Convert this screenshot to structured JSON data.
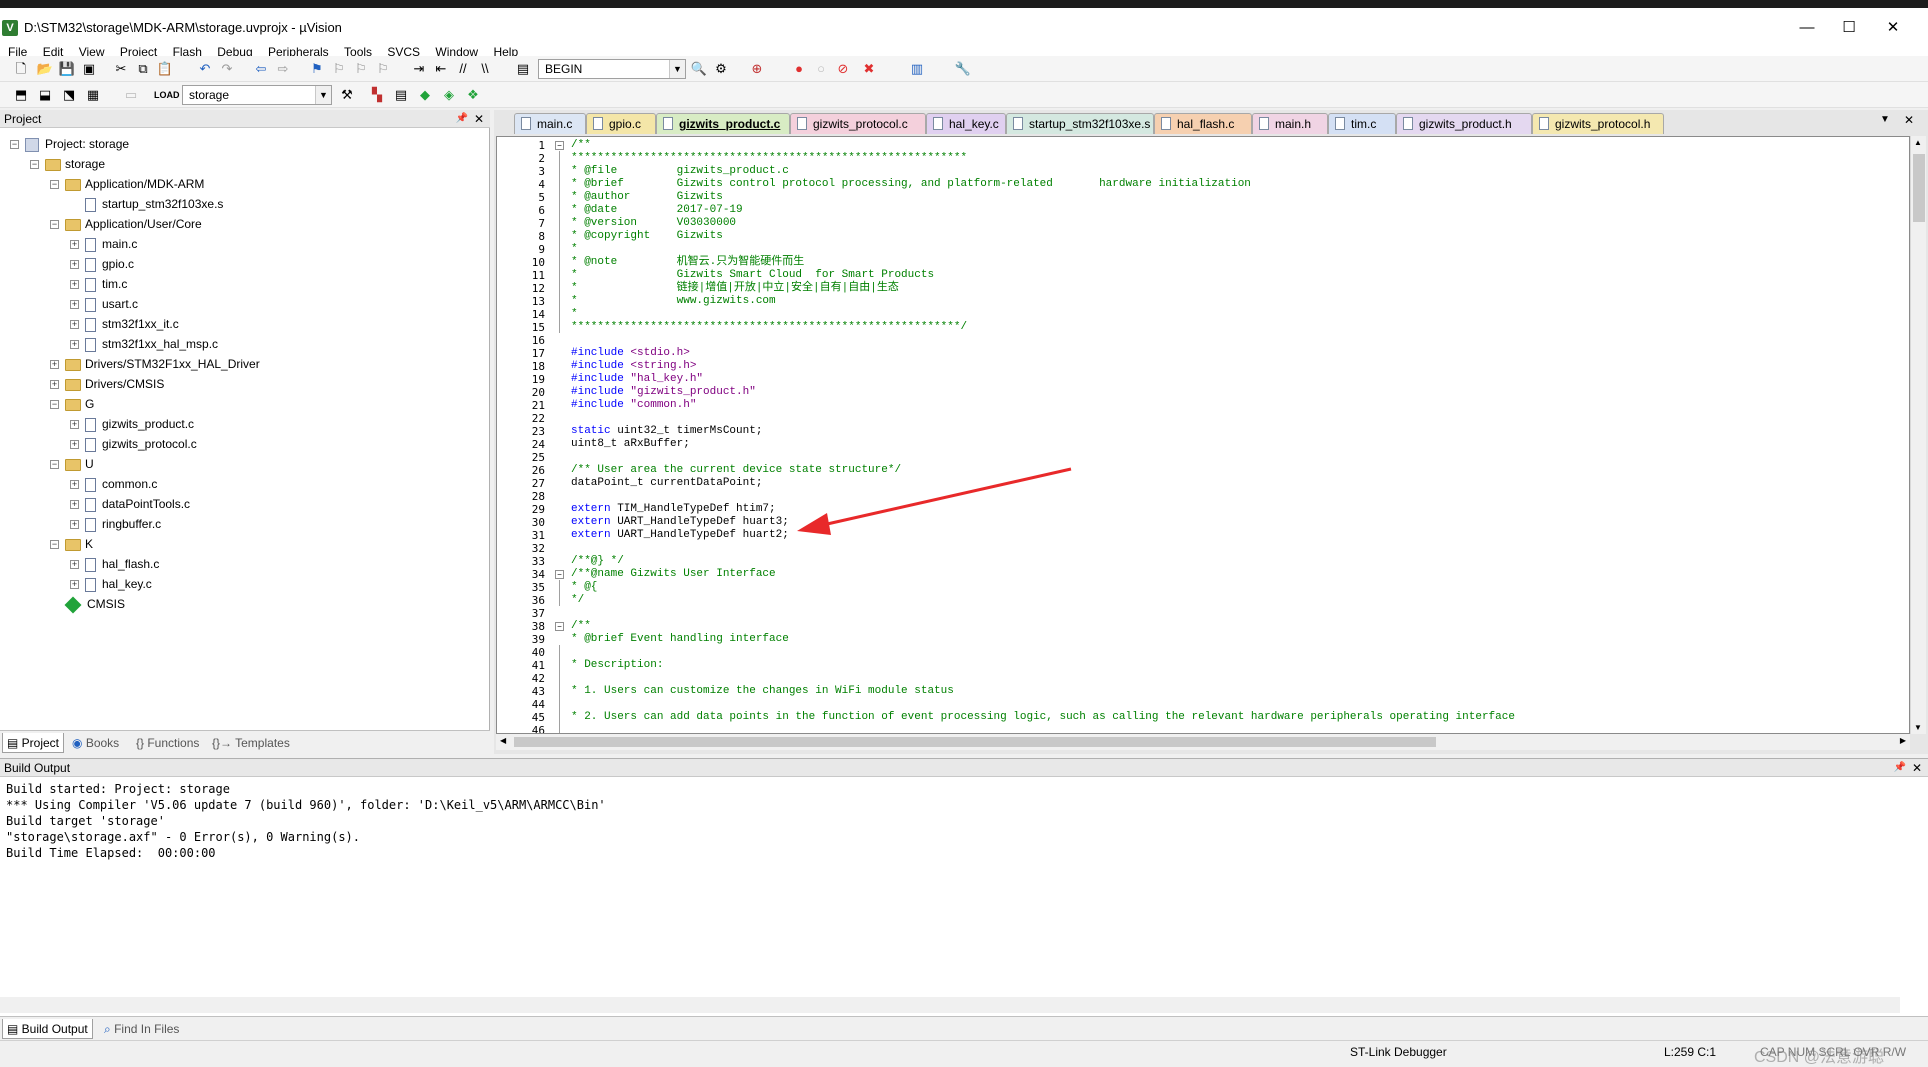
{
  "window": {
    "title": "D:\\STM32\\storage\\MDK-ARM\\storage.uvprojx - µVision",
    "app_icon_label": "V",
    "controls": {
      "minimize": "—",
      "maximize": "☐",
      "close": "✕"
    }
  },
  "menu": [
    "File",
    "Edit",
    "View",
    "Project",
    "Flash",
    "Debug",
    "Peripherals",
    "Tools",
    "SVCS",
    "Window",
    "Help"
  ],
  "toolbar1": {
    "find_combo": "BEGIN"
  },
  "toolbar2": {
    "target_combo": "storage"
  },
  "project_panel": {
    "title": "Project",
    "pin": "📌",
    "close": "✕",
    "tree": [
      {
        "label": "Project: storage",
        "level": 0,
        "kind": "project",
        "exp": "−"
      },
      {
        "label": "storage",
        "level": 1,
        "kind": "folder",
        "exp": "−"
      },
      {
        "label": "Application/MDK-ARM",
        "level": 2,
        "kind": "folder",
        "exp": "−"
      },
      {
        "label": "startup_stm32f103xe.s",
        "level": 3,
        "kind": "file",
        "exp": ""
      },
      {
        "label": "Application/User/Core",
        "level": 2,
        "kind": "folder",
        "exp": "−"
      },
      {
        "label": "main.c",
        "level": 3,
        "kind": "file",
        "exp": "+"
      },
      {
        "label": "gpio.c",
        "level": 3,
        "kind": "file",
        "exp": "+"
      },
      {
        "label": "tim.c",
        "level": 3,
        "kind": "file",
        "exp": "+"
      },
      {
        "label": "usart.c",
        "level": 3,
        "kind": "file",
        "exp": "+"
      },
      {
        "label": "stm32f1xx_it.c",
        "level": 3,
        "kind": "file",
        "exp": "+"
      },
      {
        "label": "stm32f1xx_hal_msp.c",
        "level": 3,
        "kind": "file",
        "exp": "+"
      },
      {
        "label": "Drivers/STM32F1xx_HAL_Driver",
        "level": 2,
        "kind": "folder",
        "exp": "+"
      },
      {
        "label": "Drivers/CMSIS",
        "level": 2,
        "kind": "folder",
        "exp": "+"
      },
      {
        "label": "G",
        "level": 2,
        "kind": "folder",
        "exp": "−"
      },
      {
        "label": "gizwits_product.c",
        "level": 3,
        "kind": "file",
        "exp": "+"
      },
      {
        "label": "gizwits_protocol.c",
        "level": 3,
        "kind": "file",
        "exp": "+"
      },
      {
        "label": "U",
        "level": 2,
        "kind": "folder",
        "exp": "−"
      },
      {
        "label": "common.c",
        "level": 3,
        "kind": "file",
        "exp": "+"
      },
      {
        "label": "dataPointTools.c",
        "level": 3,
        "kind": "file",
        "exp": "+"
      },
      {
        "label": "ringbuffer.c",
        "level": 3,
        "kind": "file",
        "exp": "+"
      },
      {
        "label": "K",
        "level": 2,
        "kind": "folder",
        "exp": "−"
      },
      {
        "label": "hal_flash.c",
        "level": 3,
        "kind": "file",
        "exp": "+"
      },
      {
        "label": "hal_key.c",
        "level": 3,
        "kind": "file",
        "exp": "+"
      },
      {
        "label": "CMSIS",
        "level": 2,
        "kind": "cmsis",
        "exp": ""
      }
    ],
    "tabs": [
      "Project",
      "Books",
      "{} Functions",
      "{}→ Templates"
    ]
  },
  "editor": {
    "tabs": [
      {
        "label": "main.c",
        "color": "#dce6f4"
      },
      {
        "label": "gpio.c",
        "color": "#f4e6a8"
      },
      {
        "label": "gizwits_product.c",
        "color": "#d8ecc4",
        "active": true
      },
      {
        "label": "gizwits_protocol.c",
        "color": "#f4d0dc"
      },
      {
        "label": "hal_key.c",
        "color": "#e0d0f0"
      },
      {
        "label": "startup_stm32f103xe.s",
        "color": "#d4e8e0"
      },
      {
        "label": "hal_flash.c",
        "color": "#f6d0b0"
      },
      {
        "label": "main.h",
        "color": "#f0d4e4"
      },
      {
        "label": "tim.c",
        "color": "#d4e0f4"
      },
      {
        "label": "gizwits_product.h",
        "color": "#e4d8f0"
      },
      {
        "label": "gizwits_protocol.h",
        "color": "#f4e8b0"
      }
    ],
    "tab_menu_icon": "▼",
    "tab_close_icon": "✕",
    "lines": [
      {
        "n": "1",
        "t": "/**",
        "c": "cm",
        "fold": "−"
      },
      {
        "n": "2",
        "t": "************************************************************",
        "c": "cm"
      },
      {
        "n": "3",
        "t": "* @file         gizwits_product.c",
        "c": "cm"
      },
      {
        "n": "4",
        "t": "* @brief        Gizwits control protocol processing, and platform-related       hardware initialization",
        "c": "cm"
      },
      {
        "n": "5",
        "t": "* @author       Gizwits",
        "c": "cm"
      },
      {
        "n": "6",
        "t": "* @date         2017-07-19",
        "c": "cm"
      },
      {
        "n": "7",
        "t": "* @version      V03030000",
        "c": "cm"
      },
      {
        "n": "8",
        "t": "* @copyright    Gizwits",
        "c": "cm"
      },
      {
        "n": "9",
        "t": "*",
        "c": "cm"
      },
      {
        "n": "10",
        "t": "* @note         机智云.只为智能硬件而生",
        "c": "cm"
      },
      {
        "n": "11",
        "t": "*               Gizwits Smart Cloud  for Smart Products",
        "c": "cm"
      },
      {
        "n": "12",
        "t": "*               链接|增值|开放|中立|安全|自有|自由|生态",
        "c": "cm"
      },
      {
        "n": "13",
        "t": "*               www.gizwits.com",
        "c": "cm"
      },
      {
        "n": "14",
        "t": "*",
        "c": "cm"
      },
      {
        "n": "15",
        "t": "***********************************************************/",
        "c": "cm"
      },
      {
        "n": "16",
        "t": "",
        "c": "tx"
      },
      {
        "n": "17",
        "t": "#include <stdio.h>",
        "c": "pp"
      },
      {
        "n": "18",
        "t": "#include <string.h>",
        "c": "pp"
      },
      {
        "n": "19",
        "t": "#include \"hal_key.h\"",
        "c": "pp"
      },
      {
        "n": "20",
        "t": "#include \"gizwits_product.h\"",
        "c": "pp"
      },
      {
        "n": "21",
        "t": "#include \"common.h\"",
        "c": "pp"
      },
      {
        "n": "22",
        "t": "",
        "c": "tx"
      },
      {
        "n": "23",
        "t": "static uint32_t timerMsCount;",
        "c": "kw1"
      },
      {
        "n": "24",
        "t": "uint8_t aRxBuffer;",
        "c": "tx"
      },
      {
        "n": "25",
        "t": "",
        "c": "tx"
      },
      {
        "n": "26",
        "t": "/** User area the current device state structure*/",
        "c": "cm"
      },
      {
        "n": "27",
        "t": "dataPoint_t currentDataPoint;",
        "c": "tx"
      },
      {
        "n": "28",
        "t": "",
        "c": "tx"
      },
      {
        "n": "29",
        "t": "extern TIM_HandleTypeDef htim7;",
        "c": "kw1"
      },
      {
        "n": "30",
        "t": "extern UART_HandleTypeDef huart3;",
        "c": "kw1"
      },
      {
        "n": "31",
        "t": "extern UART_HandleTypeDef huart2;",
        "c": "kw1"
      },
      {
        "n": "32",
        "t": "",
        "c": "tx"
      },
      {
        "n": "33",
        "t": "/**@} */",
        "c": "cm"
      },
      {
        "n": "34",
        "t": "/**@name Gizwits User Interface",
        "c": "cm",
        "fold": "−"
      },
      {
        "n": "35",
        "t": "* @{",
        "c": "cm"
      },
      {
        "n": "36",
        "t": "*/",
        "c": "cm"
      },
      {
        "n": "37",
        "t": "",
        "c": "tx"
      },
      {
        "n": "38",
        "t": "/**",
        "c": "cm",
        "fold": "−"
      },
      {
        "n": "39",
        "t": "* @brief Event handling interface",
        "c": "cm"
      },
      {
        "n": "40",
        "t": "",
        "c": "tx"
      },
      {
        "n": "41",
        "t": "* Description:",
        "c": "cm"
      },
      {
        "n": "42",
        "t": "",
        "c": "tx"
      },
      {
        "n": "43",
        "t": "* 1. Users can customize the changes in WiFi module status",
        "c": "cm"
      },
      {
        "n": "44",
        "t": "",
        "c": "tx"
      },
      {
        "n": "45",
        "t": "* 2. Users can add data points in the function of event processing logic, such as calling the relevant hardware peripherals operating interface",
        "c": "cm"
      },
      {
        "n": "46",
        "t": "",
        "c": "tx"
      }
    ]
  },
  "build_output": {
    "title": "Build Output",
    "lines": [
      "Build started: Project: storage",
      "*** Using Compiler 'V5.06 update 7 (build 960)', folder: 'D:\\Keil_v5\\ARM\\ARMCC\\Bin'",
      "Build target 'storage'",
      "\"storage\\storage.axf\" - 0 Error(s), 0 Warning(s).",
      "Build Time Elapsed:  00:00:00"
    ],
    "tabs": [
      "Build Output",
      "Find In Files"
    ]
  },
  "status": {
    "debugger": "ST-Link Debugger",
    "position": "L:259 C:1",
    "caps": "CAP NUM SCRL OVR R/W",
    "watermark": "CSDN @法意游聪"
  },
  "colors": {
    "arrow": "#e8292a",
    "comment": "#008000",
    "keyword": "#0000ff",
    "preprocessor": "#808000",
    "string": "#800080"
  }
}
